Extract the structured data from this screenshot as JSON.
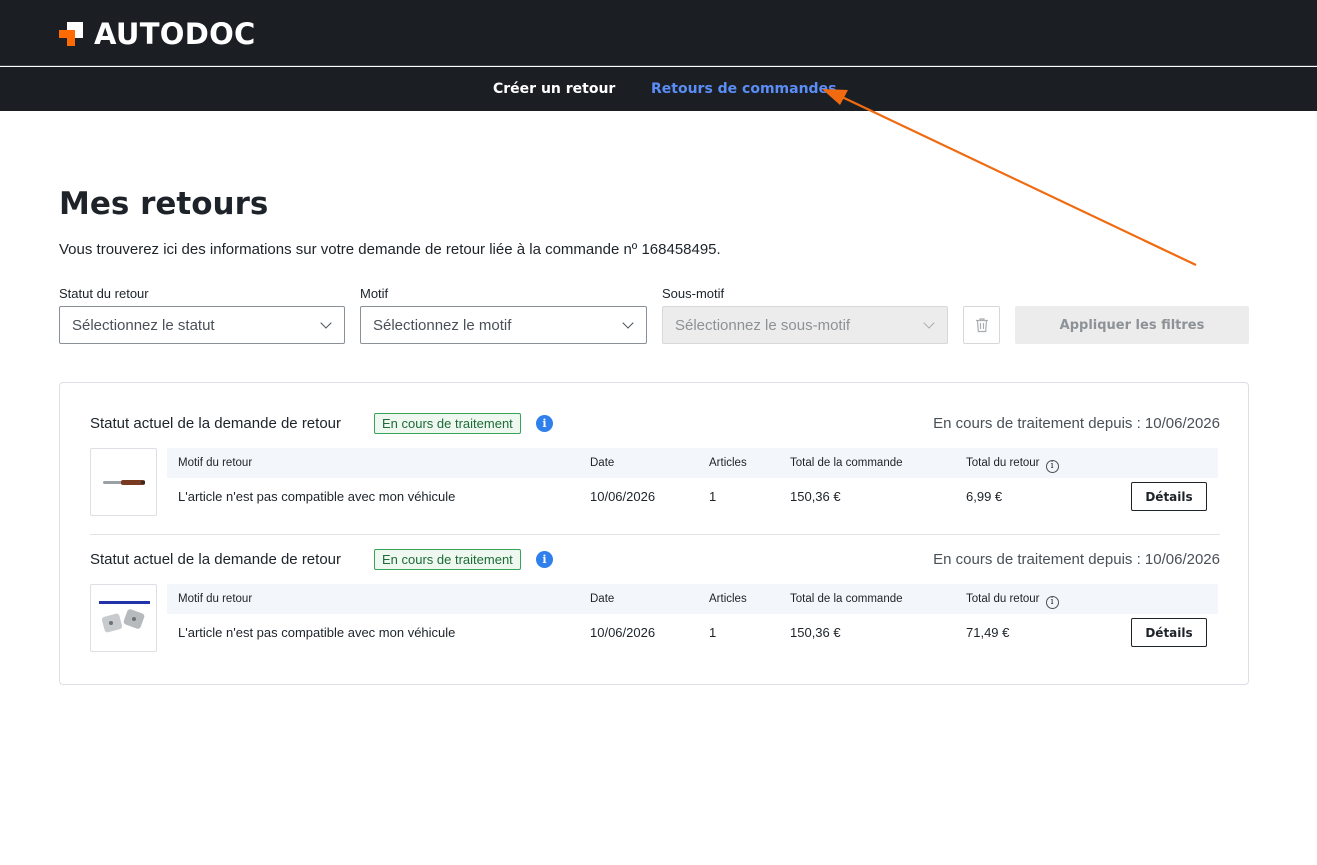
{
  "header": {
    "logo_text": "AUTODOC",
    "brand_color": "#ff6b00"
  },
  "nav": {
    "create_label": "Créer un retour",
    "returns_label": "Retours de commandes"
  },
  "page": {
    "title": "Mes retours",
    "intro": "Vous trouverez ici des informations sur votre demande de retour liée à la commande nº 168458495."
  },
  "filters": {
    "status_label": "Statut du retour",
    "status_placeholder": "Sélectionnez le statut",
    "reason_label": "Motif",
    "reason_placeholder": "Sélectionnez le motif",
    "subreason_label": "Sous-motif",
    "subreason_placeholder": "Sélectionnez le sous-motif",
    "apply_label": "Appliquer les filtres"
  },
  "columns": {
    "reason": "Motif du retour",
    "date": "Date",
    "articles": "Articles",
    "order_total": "Total de la commande",
    "return_total": "Total du retour"
  },
  "returns": [
    {
      "status_title": "Statut actuel de la demande de retour",
      "badge": "En cours de traitement",
      "since": "En cours de traitement depuis : 10/06/2026",
      "reason": "L'article n'est pas compatible avec mon véhicule",
      "date": "10/06/2026",
      "articles": "1",
      "order_total": "150,36 €",
      "return_total": "6,99 €",
      "details_label": "Détails",
      "thumb_icon": "wiper-blade-product-icon"
    },
    {
      "status_title": "Statut actuel de la demande de retour",
      "badge": "En cours de traitement",
      "since": "En cours de traitement depuis : 10/06/2026",
      "reason": "L'article n'est pas compatible avec mon véhicule",
      "date": "10/06/2026",
      "articles": "1",
      "order_total": "150,36 €",
      "return_total": "71,49 €",
      "details_label": "Détails",
      "thumb_icon": "brake-pads-product-icon"
    }
  ]
}
